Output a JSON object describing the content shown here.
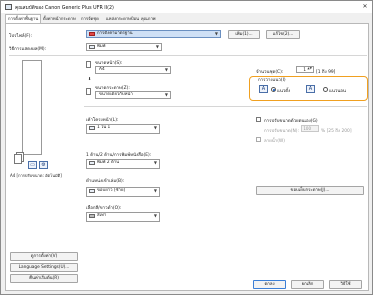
{
  "window": {
    "title": "คุณสมบัติของ Canon Generic Plus UFR II(2)",
    "close_glyph": "✕"
  },
  "tabs": [
    {
      "label": "การตั้งค่าพื้นฐาน",
      "active": true
    },
    {
      "label": "ตั้งค่าหน้ากระดาษ",
      "active": false
    },
    {
      "label": "การจัดชุด",
      "active": false
    },
    {
      "label": "แหล่งกระดาษป้อน",
      "active": false
    },
    {
      "label": "คุณภาพ",
      "active": false
    }
  ],
  "profile": {
    "label": "โปรไฟล์(F):",
    "value": "การตั้งค่ามาตรฐาน",
    "add_button": "เพิ่ม(1)...",
    "edit_button": "แก้ไข(2)..."
  },
  "output_method": {
    "label": "วิธีการแสดงผล(M):",
    "value": "พิมพ์"
  },
  "paper_size": {
    "label": "ขนาดหน้า(S):",
    "value": "A4"
  },
  "output_size": {
    "label": "ขนาดกระดาษ(Z):",
    "value": "ขนาดเดียวกับหน้า"
  },
  "copies": {
    "label": "จำนวนชุด(C):",
    "value": "1",
    "range": "[1 ถึง 99]"
  },
  "orientation": {
    "label": "การวางแนว(I)",
    "options": [
      {
        "label": "แนวตั้ง",
        "icon": "A",
        "selected": true
      },
      {
        "label": "แนวนอน",
        "icon": "A",
        "selected": false
      }
    ]
  },
  "page_layout": {
    "label": "เค้าโครงหน้า(L):",
    "value": "1 ใน 1"
  },
  "manual_scaling": {
    "label": "การปรับขนาดด้วยตนเอง(G)",
    "checked": false,
    "scaling_label": "การปรับขนาด(N):",
    "scaling_value": "100",
    "scaling_range": "% [25 ถึง 200]",
    "watermark_label": "ลายน้ำ(W)",
    "watermark_checked": false
  },
  "duplex": {
    "label": "1 ด้าน/2 ด้าน/การพิมพ์หนังสือ(E):",
    "value": "พิมพ์ 2 ด้าน"
  },
  "binding": {
    "label": "ตำแหน่งเข้าเล่ม(B):",
    "value": "ขอบยาว [ซ้าย]",
    "margin_button": "ขอบเย็บกระดาษ(J)..."
  },
  "color_mode": {
    "label": "เลือกสี/ขาวดำ(O):",
    "value": "สีเทา"
  },
  "preview": {
    "caption": "A4 [การปรับขนาด: อัตโนมัติ]"
  },
  "side_buttons": [
    {
      "label": "ดูการตั้งค่า(V)"
    },
    {
      "label": "Language Settings(U)..."
    },
    {
      "label": "คืนค่าเริ่มต้น(R)"
    }
  ],
  "footer": {
    "ok": "ตกลง",
    "cancel": "ยกเลิก",
    "help": "วิธีใช้"
  }
}
